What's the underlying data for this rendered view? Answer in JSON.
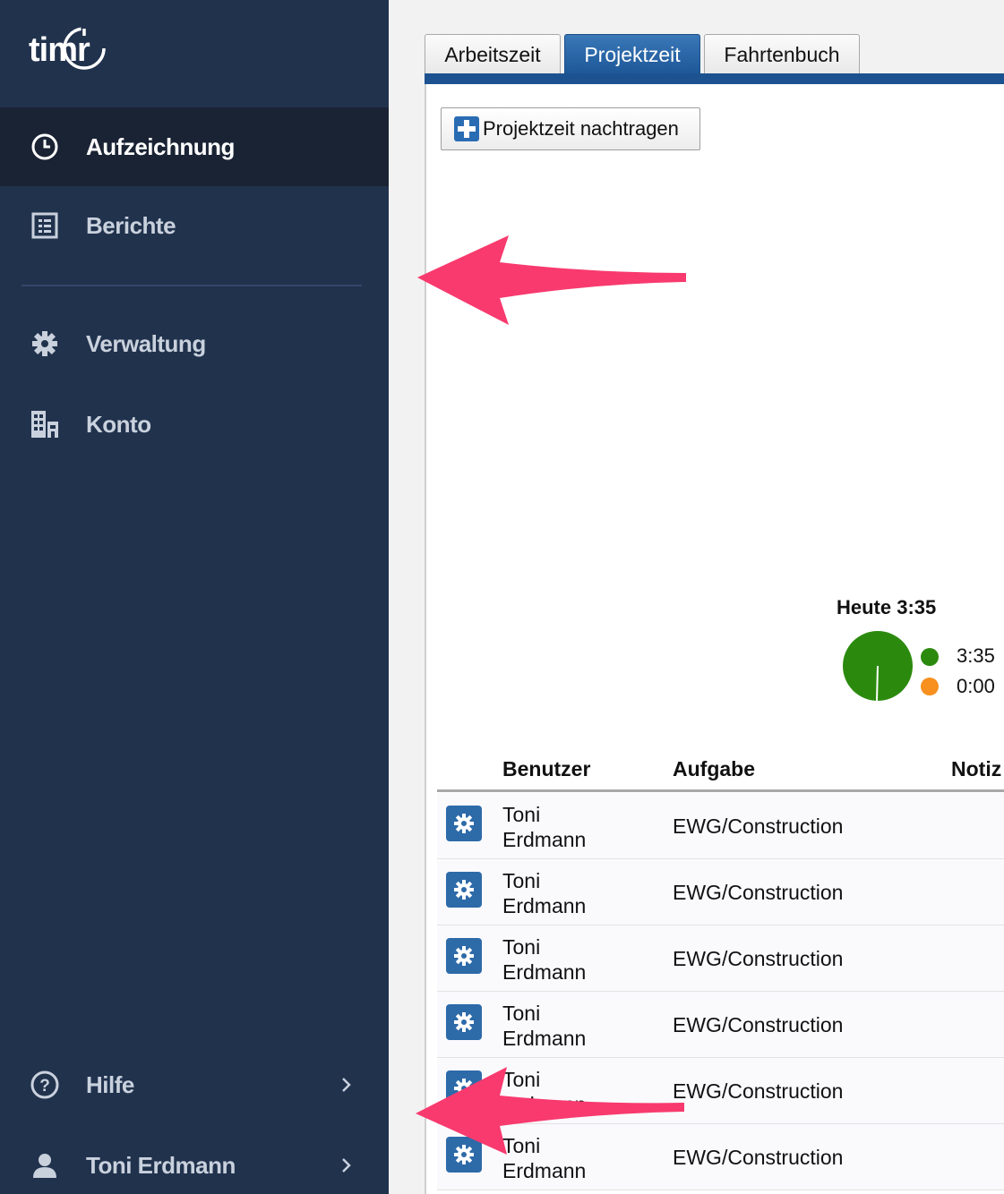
{
  "sidebar": {
    "logo_text": "timr",
    "items": [
      {
        "label": "Aufzeichnung",
        "icon": "clock-icon",
        "active": true
      },
      {
        "label": "Berichte",
        "icon": "report-icon",
        "active": false
      },
      {
        "label": "Verwaltung",
        "icon": "gear-icon",
        "active": false
      },
      {
        "label": "Konto",
        "icon": "building-icon",
        "active": false
      }
    ],
    "bottom": [
      {
        "label": "Hilfe",
        "icon": "help-icon"
      },
      {
        "label": "Toni Erdmann",
        "icon": "user-icon"
      }
    ]
  },
  "tabs": [
    {
      "label": "Arbeitszeit",
      "active": false
    },
    {
      "label": "Projektzeit",
      "active": true
    },
    {
      "label": "Fahrtenbuch",
      "active": false
    }
  ],
  "toolbar": {
    "add_label": "Projektzeit nachtragen"
  },
  "summary": {
    "title": "Heute 3:35",
    "legend": [
      {
        "value": "3:35",
        "color": "#2b8a0e"
      },
      {
        "value": "0:00",
        "color": "#f7901e"
      }
    ]
  },
  "table": {
    "headers": [
      "Benutzer",
      "Aufgabe",
      "Notiz"
    ],
    "rows": [
      {
        "user_first": "Toni",
        "user_last": "Erdmann",
        "task": "EWG/Construction"
      },
      {
        "user_first": "Toni",
        "user_last": "Erdmann",
        "task": "EWG/Construction"
      },
      {
        "user_first": "Toni",
        "user_last": "Erdmann",
        "task": "EWG/Construction"
      },
      {
        "user_first": "Toni",
        "user_last": "Erdmann",
        "task": "EWG/Construction"
      },
      {
        "user_first": "Toni",
        "user_last": "Erdmann",
        "task": "EWG/Construction"
      },
      {
        "user_first": "Toni",
        "user_last": "Erdmann",
        "task": "EWG/Construction"
      }
    ]
  },
  "colors": {
    "sidebar_bg": "#21324d",
    "active_tab": "#1d5290",
    "arrow": "#f83a6e",
    "pie_green": "#2b8a0e"
  }
}
